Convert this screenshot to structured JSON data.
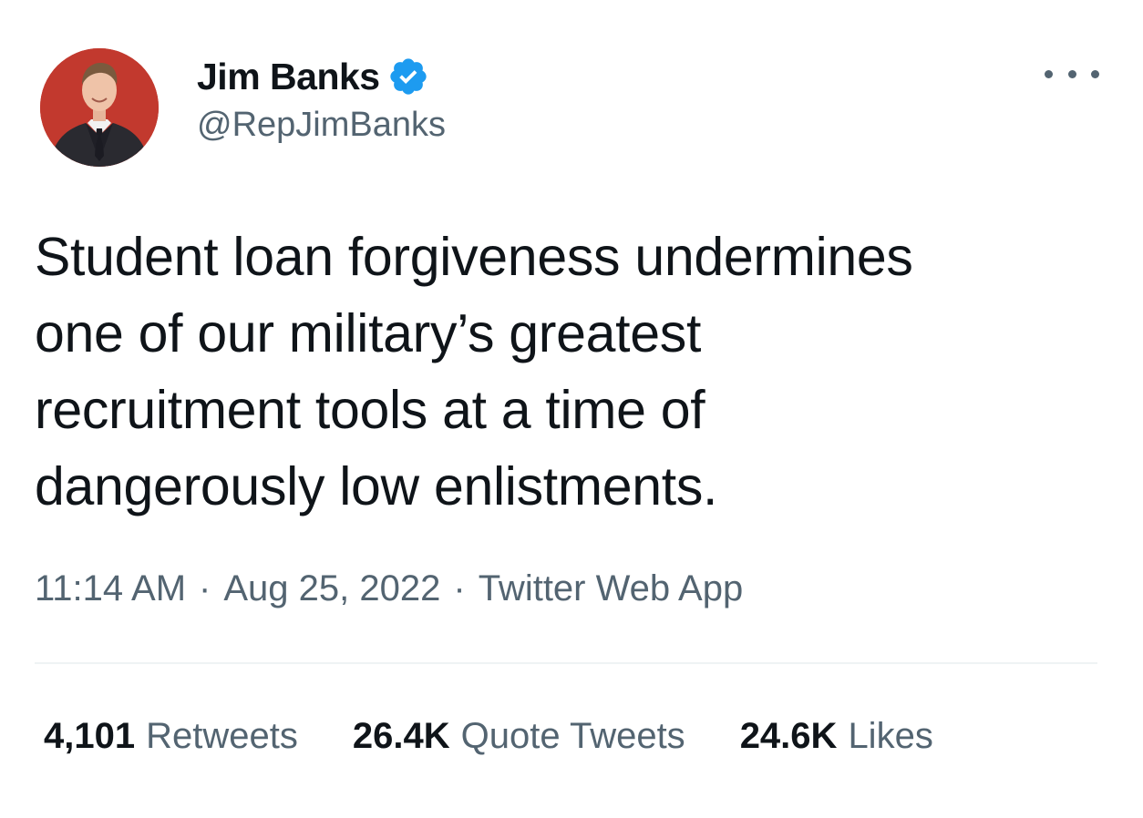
{
  "author": {
    "display_name": "Jim Banks",
    "handle": "@RepJimBanks",
    "verified": true,
    "avatar_icon": "profile-photo",
    "avatar_bg": "#c2392e"
  },
  "more_icon": "more-options-icon",
  "tweet": {
    "lines": [
      "Student loan forgiveness undermines",
      "one of our military’s greatest",
      "recruitment tools at a time of",
      "dangerously low enlistments."
    ]
  },
  "meta": {
    "time": "11:14 AM",
    "separator": "·",
    "date": "Aug 25, 2022",
    "source": "Twitter Web App"
  },
  "stats": {
    "retweets": {
      "count": "4,101",
      "label": "Retweets"
    },
    "quotes": {
      "count": "26.4K",
      "label": "Quote Tweets"
    },
    "likes": {
      "count": "24.6K",
      "label": "Likes"
    }
  },
  "colors": {
    "text": "#0f1419",
    "secondary": "#536471",
    "verified_badge": "#1d9bf0",
    "divider": "#eff3f4"
  }
}
